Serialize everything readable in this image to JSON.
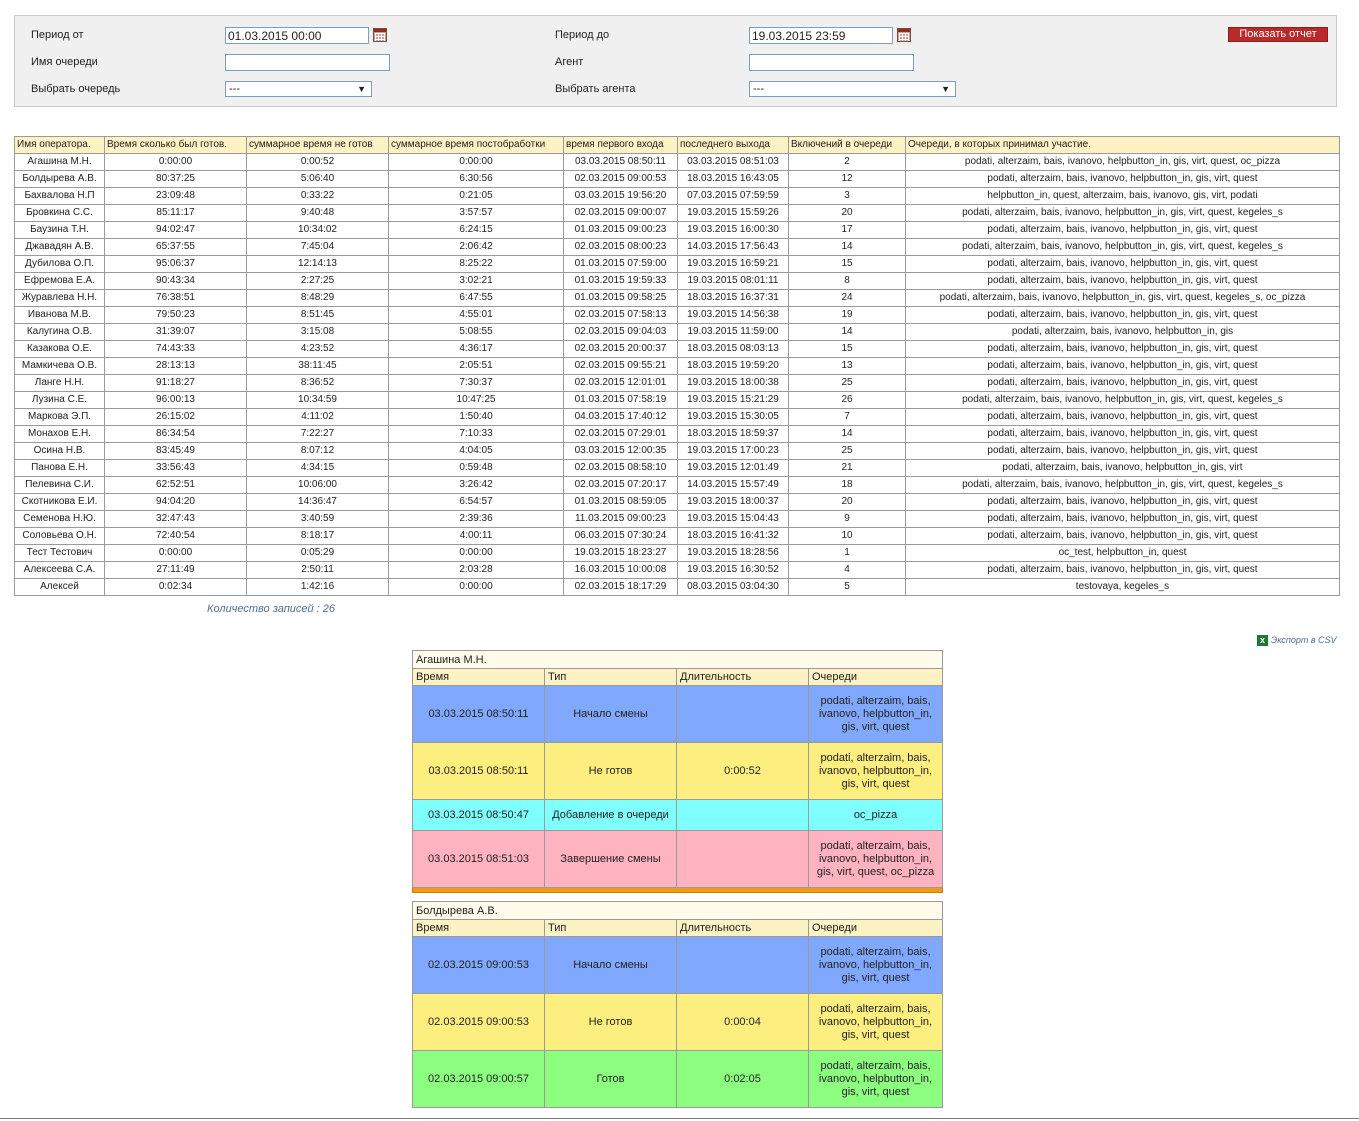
{
  "filter": {
    "period_from_label": "Период от",
    "period_from_value": "01.03.2015 00:00",
    "period_to_label": "Период до",
    "period_to_value": "19.03.2015 23:59",
    "queue_name_label": "Имя очереди",
    "queue_name_value": "",
    "agent_label": "Агент",
    "agent_value": "",
    "select_queue_label": "Выбрать очередь",
    "select_queue_value": "---",
    "select_agent_label": "Выбрать агента",
    "select_agent_value": "---",
    "show_report_button": "Показать отчет"
  },
  "main_table": {
    "headers": [
      "Имя оператора.",
      "Время сколько был готов.",
      "суммарное время не готов",
      "суммарное время постобработки",
      "время первого входа",
      "последнего выхода",
      "Включений в очереди",
      "Очереди, в которых принимал участие."
    ],
    "rows": [
      [
        "Агашина М.Н.",
        "0:00:00",
        "0:00:52",
        "0:00:00",
        "03.03.2015 08:50:11",
        "03.03.2015 08:51:03",
        "2",
        "podati, alterzaim, bais, ivanovo, helpbutton_in, gis, virt, quest, oc_pizza"
      ],
      [
        "Болдырева А.В.",
        "80:37:25",
        "5:06:40",
        "6:30:56",
        "02.03.2015 09:00:53",
        "18.03.2015 16:43:05",
        "12",
        "podati, alterzaim, bais, ivanovo, helpbutton_in, gis, virt, quest"
      ],
      [
        "Бахвалова Н.П",
        "23:09:48",
        "0:33:22",
        "0:21:05",
        "03.03.2015 19:56:20",
        "07.03.2015 07:59:59",
        "3",
        "helpbutton_in, quest, alterzaim, bais, ivanovo, gis, virt, podati"
      ],
      [
        "Бровкина С.С.",
        "85:11:17",
        "9:40:48",
        "3:57:57",
        "02.03.2015 09:00:07",
        "19.03.2015 15:59:26",
        "20",
        "podati, alterzaim, bais, ivanovo, helpbutton_in, gis, virt, quest, kegeles_s"
      ],
      [
        "Баузина Т.Н.",
        "94:02:47",
        "10:34:02",
        "6:24:15",
        "01.03.2015 09:00:23",
        "19.03.2015 16:00:30",
        "17",
        "podati, alterzaim, bais, ivanovo, helpbutton_in, gis, virt, quest"
      ],
      [
        "Джавадян А.В.",
        "65:37:55",
        "7:45:04",
        "2:06:42",
        "02.03.2015 08:00:23",
        "14.03.2015 17:56:43",
        "14",
        "podati, alterzaim, bais, ivanovo, helpbutton_in, gis, virt, quest, kegeles_s"
      ],
      [
        "Дубилова О.П.",
        "95:06:37",
        "12:14:13",
        "8:25:22",
        "01.03.2015 07:59:00",
        "19.03.2015 16:59:21",
        "15",
        "podati, alterzaim, bais, ivanovo, helpbutton_in, gis, virt, quest"
      ],
      [
        "Ефремова Е.А.",
        "90:43:34",
        "2:27:25",
        "3:02:21",
        "01.03.2015 19:59:33",
        "19.03.2015 08:01:11",
        "8",
        "podati, alterzaim, bais, ivanovo, helpbutton_in, gis, virt, quest"
      ],
      [
        "Журавлева Н.Н.",
        "76:38:51",
        "8:48:29",
        "6:47:55",
        "01.03.2015 09:58:25",
        "18.03.2015 16:37:31",
        "24",
        "podati, alterzaim, bais, ivanovo, helpbutton_in, gis, virt, quest, kegeles_s, oc_pizza"
      ],
      [
        "Иванова М.В.",
        "79:50:23",
        "8:51:45",
        "4:55:01",
        "02.03.2015 07:58:13",
        "19.03.2015 14:56:38",
        "19",
        "podati, alterzaim, bais, ivanovo, helpbutton_in, gis, virt, quest"
      ],
      [
        "Калугина О.В.",
        "31:39:07",
        "3:15:08",
        "5:08:55",
        "02.03.2015 09:04:03",
        "19.03.2015 11:59:00",
        "14",
        "podati, alterzaim, bais, ivanovo, helpbutton_in, gis"
      ],
      [
        "Казакова О.Е.",
        "74:43:33",
        "4:23:52",
        "4:36:17",
        "02.03.2015 20:00:37",
        "18.03.2015 08:03:13",
        "15",
        "podati, alterzaim, bais, ivanovo, helpbutton_in, gis, virt, quest"
      ],
      [
        "Мамкичева О.В.",
        "28:13:13",
        "38:11:45",
        "2:05:51",
        "02.03.2015 09:55:21",
        "18.03.2015 19:59:20",
        "13",
        "podati, alterzaim, bais, ivanovo, helpbutton_in, gis, virt, quest"
      ],
      [
        "Ланге Н.Н.",
        "91:18:27",
        "8:36:52",
        "7:30:37",
        "02.03.2015 12:01:01",
        "19.03.2015 18:00:38",
        "25",
        "podati, alterzaim, bais, ivanovo, helpbutton_in, gis, virt, quest"
      ],
      [
        "Лузина С.Е.",
        "96:00:13",
        "10:34:59",
        "10:47:25",
        "01.03.2015 07:58:19",
        "19.03.2015 15:21:29",
        "26",
        "podati, alterzaim, bais, ivanovo, helpbutton_in, gis, virt, quest, kegeles_s"
      ],
      [
        "Маркова Э.П.",
        "26:15:02",
        "4:11:02",
        "1:50:40",
        "04.03.2015 17:40:12",
        "19.03.2015 15:30:05",
        "7",
        "podati, alterzaim, bais, ivanovo, helpbutton_in, gis, virt, quest"
      ],
      [
        "Монахов Е.Н.",
        "86:34:54",
        "7:22:27",
        "7:10:33",
        "02.03.2015 07:29:01",
        "18.03.2015 18:59:37",
        "14",
        "podati, alterzaim, bais, ivanovo, helpbutton_in, gis, virt, quest"
      ],
      [
        "Осина Н.В.",
        "83:45:49",
        "8:07:12",
        "4:04:05",
        "03.03.2015 12:00:35",
        "19.03.2015 17:00:23",
        "25",
        "podati, alterzaim, bais, ivanovo, helpbutton_in, gis, virt, quest"
      ],
      [
        "Панова Е.Н.",
        "33:56:43",
        "4:34:15",
        "0:59:48",
        "02.03.2015 08:58:10",
        "19.03.2015 12:01:49",
        "21",
        "podati, alterzaim, bais, ivanovo, helpbutton_in, gis, virt"
      ],
      [
        "Пелевина С.И.",
        "62:52:51",
        "10:06:00",
        "3:26:42",
        "02.03.2015 07:20:17",
        "14.03.2015 15:57:49",
        "18",
        "podati, alterzaim, bais, ivanovo, helpbutton_in, gis, virt, quest, kegeles_s"
      ],
      [
        "Скотникова Е.И.",
        "94:04:20",
        "14:36:47",
        "6:54:57",
        "01.03.2015 08:59:05",
        "19.03.2015 18:00:37",
        "20",
        "podati, alterzaim, bais, ivanovo, helpbutton_in, gis, virt, quest"
      ],
      [
        "Семенова Н.Ю.",
        "32:47:43",
        "3:40:59",
        "2:39:36",
        "11.03.2015 09:00:23",
        "19.03.2015 15:04:43",
        "9",
        "podati, alterzaim, bais, ivanovo, helpbutton_in, gis, virt, quest"
      ],
      [
        "Соловьева О.Н.",
        "72:40:54",
        "8:18:17",
        "4:00:11",
        "06.03.2015 07:30:24",
        "18.03.2015 16:41:32",
        "10",
        "podati, alterzaim, bais, ivanovo, helpbutton_in, gis, virt, quest"
      ],
      [
        "Тест Тестович",
        "0:00:00",
        "0:05:29",
        "0:00:00",
        "19.03.2015 18:23:27",
        "19.03.2015 18:28:56",
        "1",
        "oc_test, helpbutton_in, quest"
      ],
      [
        "Алексеева С.А.",
        "27:11:49",
        "2:50:11",
        "2:03:28",
        "16.03.2015 10:00:08",
        "19.03.2015 16:30:52",
        "4",
        "podati, alterzaim, bais, ivanovo, helpbutton_in, gis, virt, quest"
      ],
      [
        "Алексей",
        "0:02:34",
        "1:42:16",
        "0:00:00",
        "02.03.2015 18:17:29",
        "08.03.2015 03:04:30",
        "5",
        "testovaya, kegeles_s"
      ]
    ]
  },
  "records_count": "Количество записей : 26",
  "export_csv": "Экспорт в CSV",
  "detail_headers": [
    "Время",
    "Тип",
    "Длительность",
    "Очереди"
  ],
  "details": [
    {
      "operator": "Агашина М.Н.",
      "rows": [
        {
          "time": "03.03.2015 08:50:11",
          "type": "Начало смены",
          "duration": "",
          "queues": "podati, alterzaim, bais, ivanovo, helpbutton_in, gis, virt, quest",
          "color": "blue"
        },
        {
          "time": "03.03.2015 08:50:11",
          "type": "Не готов",
          "duration": "0:00:52",
          "queues": "podati, alterzaim, bais, ivanovo, helpbutton_in, gis, virt, quest",
          "color": "yellow"
        },
        {
          "time": "03.03.2015 08:50:47",
          "type": "Добавление в очереди",
          "duration": "",
          "queues": "oc_pizza",
          "color": "cyan"
        },
        {
          "time": "03.03.2015 08:51:03",
          "type": "Завершение смены",
          "duration": "",
          "queues": "podati, alterzaim, bais, ivanovo, helpbutton_in, gis, virt, quest, oc_pizza",
          "color": "pink"
        }
      ]
    },
    {
      "operator": "Болдырева А.В.",
      "rows": [
        {
          "time": "02.03.2015 09:00:53",
          "type": "Начало смены",
          "duration": "",
          "queues": "podati, alterzaim, bais, ivanovo, helpbutton_in, gis, virt, quest",
          "color": "blue"
        },
        {
          "time": "02.03.2015 09:00:53",
          "type": "Не готов",
          "duration": "0:00:04",
          "queues": "podati, alterzaim, bais, ivanovo, helpbutton_in, gis, virt, quest",
          "color": "yellow"
        },
        {
          "time": "02.03.2015 09:00:57",
          "type": "Готов",
          "duration": "0:02:05",
          "queues": "podati, alterzaim, bais, ivanovo, helpbutton_in, gis, virt, quest",
          "color": "green"
        }
      ]
    }
  ],
  "colors": {
    "blue": "#80a8ff",
    "yellow": "#fdee80",
    "cyan": "#80ffff",
    "pink": "#ffb2bf",
    "green": "#8dff80",
    "header": "#fcf2c4",
    "button": "#b92a2a",
    "separator": "#f39c12"
  }
}
